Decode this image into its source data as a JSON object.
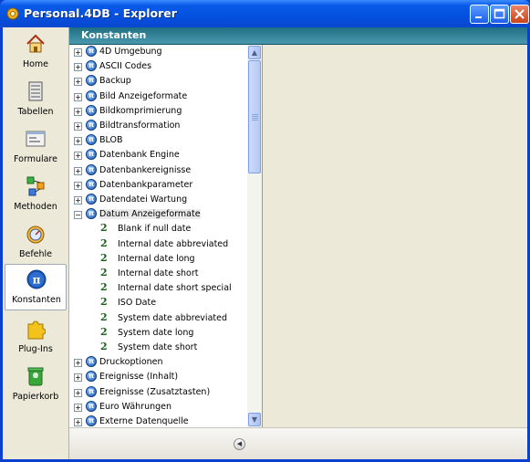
{
  "window": {
    "title": "Personal.4DB - Explorer"
  },
  "sidebar": {
    "items": [
      {
        "label": "Home",
        "icon": "home-icon"
      },
      {
        "label": "Tabellen",
        "icon": "tables-icon"
      },
      {
        "label": "Formulare",
        "icon": "forms-icon"
      },
      {
        "label": "Methoden",
        "icon": "methods-icon"
      },
      {
        "label": "Befehle",
        "icon": "commands-icon"
      },
      {
        "label": "Konstanten",
        "icon": "constants-icon"
      },
      {
        "label": "Plug-Ins",
        "icon": "plugins-icon"
      },
      {
        "label": "Papierkorb",
        "icon": "trash-icon"
      }
    ],
    "active_index": 5
  },
  "panel": {
    "title": "Konstanten"
  },
  "tree": {
    "rows": [
      {
        "label": "4D Umgebung",
        "type": "group",
        "expanded": false
      },
      {
        "label": "ASCII Codes",
        "type": "group",
        "expanded": false
      },
      {
        "label": "Backup",
        "type": "group",
        "expanded": false
      },
      {
        "label": "Bild Anzeigeformate",
        "type": "group",
        "expanded": false
      },
      {
        "label": "Bildkomprimierung",
        "type": "group",
        "expanded": false
      },
      {
        "label": "Bildtransformation",
        "type": "group",
        "expanded": false
      },
      {
        "label": "BLOB",
        "type": "group",
        "expanded": false
      },
      {
        "label": "Datenbank Engine",
        "type": "group",
        "expanded": false
      },
      {
        "label": "Datenbankereignisse",
        "type": "group",
        "expanded": false
      },
      {
        "label": "Datenbankparameter",
        "type": "group",
        "expanded": false
      },
      {
        "label": "Datendatei Wartung",
        "type": "group",
        "expanded": false
      },
      {
        "label": "Datum Anzeigeformate",
        "type": "group",
        "expanded": true,
        "selected": true
      },
      {
        "label": "Blank if null date",
        "type": "constant"
      },
      {
        "label": "Internal date abbreviated",
        "type": "constant"
      },
      {
        "label": "Internal date long",
        "type": "constant"
      },
      {
        "label": "Internal date short",
        "type": "constant"
      },
      {
        "label": "Internal date short special",
        "type": "constant"
      },
      {
        "label": "ISO Date",
        "type": "constant"
      },
      {
        "label": "System date abbreviated",
        "type": "constant"
      },
      {
        "label": "System date long",
        "type": "constant"
      },
      {
        "label": "System date short",
        "type": "constant"
      },
      {
        "label": "Druckoptionen",
        "type": "group",
        "expanded": false
      },
      {
        "label": "Ereignisse (Inhalt)",
        "type": "group",
        "expanded": false
      },
      {
        "label": "Ereignisse (Zusatztasten)",
        "type": "group",
        "expanded": false
      },
      {
        "label": "Euro Währungen",
        "type": "group",
        "expanded": false
      },
      {
        "label": "Externe Datenquelle",
        "type": "group",
        "expanded": false
      }
    ]
  },
  "colors": {
    "title_bar": "#0a5ae8",
    "panel_header": "#2a7a8e",
    "constant_icon": "#1a5f1a",
    "group_icon": "#1c56b5"
  }
}
